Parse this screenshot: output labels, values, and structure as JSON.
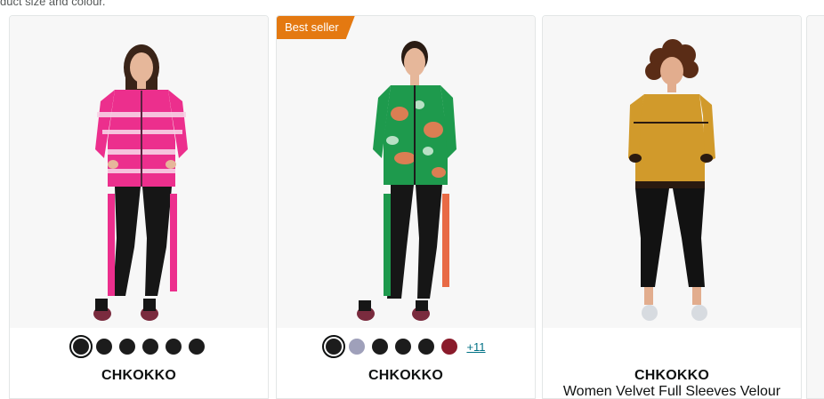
{
  "top_note": "duct size and colour.",
  "products": [
    {
      "badge": "",
      "brand": "CHKOKKO",
      "title": "",
      "top_color": "#ec2f8d",
      "swatches": [
        "#1c1c1c",
        "#1c1c1c",
        "#1c1c1c",
        "#1c1c1c",
        "#1c1c1c",
        "#1c1c1c"
      ],
      "more_label": ""
    },
    {
      "badge": "Best seller",
      "brand": "CHKOKKO",
      "title": "",
      "top_color": "#1e9a4d",
      "swatches": [
        "#1c1c1c",
        "#9fa0ba",
        "#1c1c1c",
        "#1c1c1c",
        "#1c1c1c",
        "#8a1b2b"
      ],
      "more_label": "+11"
    },
    {
      "badge": "",
      "brand": "CHKOKKO",
      "title": "Women Velvet Full Sleeves Velour",
      "top_color": "#d19a2b",
      "swatches": [],
      "more_label": ""
    }
  ],
  "colors": {
    "badge": "#e47911",
    "link": "#007185",
    "card_border": "#e3e6e6",
    "image_bg": "#f7f7f7"
  }
}
